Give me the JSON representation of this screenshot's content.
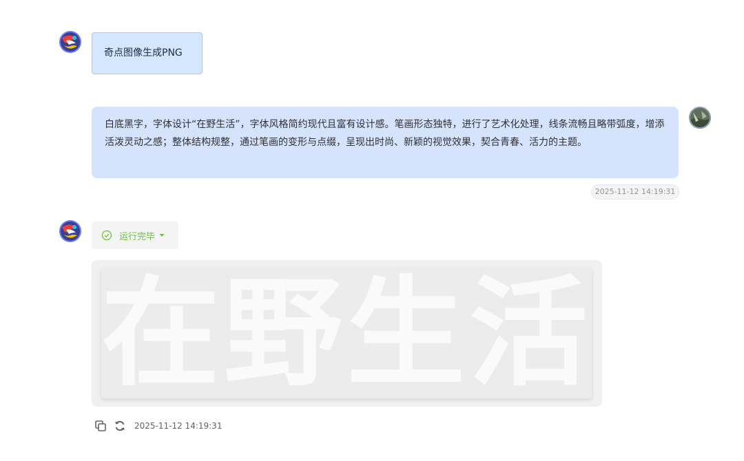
{
  "messages": {
    "title_message": {
      "text": "奇点图像生成PNG"
    },
    "user_prompt": {
      "text": "白底黑字，字体设计“在野生活”，字体风格简约现代且富有设计感。笔画形态独特，进行了艺术化处理，线条流畅且略带弧度，增添活泼灵动之感；整体结构规整，通过笔画的变形与点缀，呈现出时尚、新颖的视觉效果，契合青春、活力的主题。",
      "timestamp": "2025-11-12 14:19:31"
    },
    "assistant_reply": {
      "status_label": "运行完毕",
      "status_color": "#67c23a",
      "image_text": "在野生活",
      "timestamp": "2025-11-12 14:19:31"
    }
  },
  "icons": {
    "assistant_avatar": "colorful-swirl-avatar",
    "user_avatar": "landscape-photo-avatar",
    "status": "check-circle-icon",
    "dropdown": "caret-down-icon",
    "copy": "copy-icon",
    "refresh": "refresh-icon"
  },
  "colors": {
    "title_bubble_bg": "#d5e6ff",
    "user_bubble_bg": "#d5e3fd",
    "success": "#67c23a"
  }
}
